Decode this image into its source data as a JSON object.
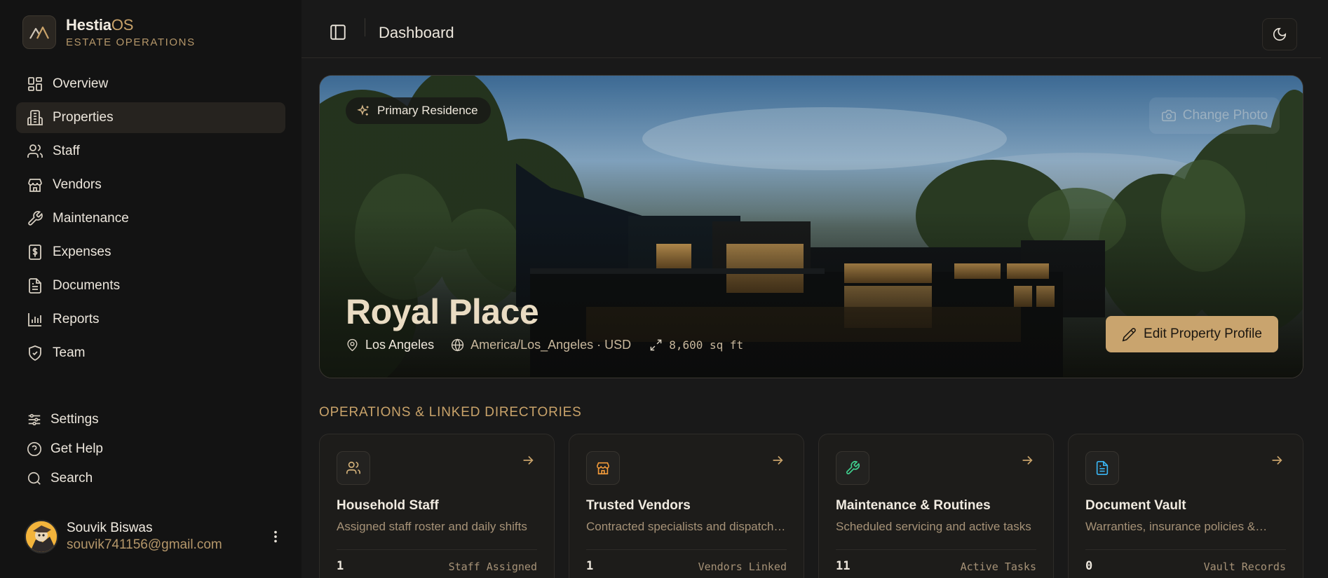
{
  "app": {
    "name_prefix": "Hestia",
    "name_suffix": "OS",
    "subtitle": "ESTATE OPERATIONS"
  },
  "sidebar": {
    "items": [
      {
        "label": "Overview",
        "icon": "grid-icon"
      },
      {
        "label": "Properties",
        "icon": "building-icon",
        "active": true
      },
      {
        "label": "Staff",
        "icon": "users-icon"
      },
      {
        "label": "Vendors",
        "icon": "store-icon"
      },
      {
        "label": "Maintenance",
        "icon": "wrench-icon"
      },
      {
        "label": "Expenses",
        "icon": "dollar-receipt-icon"
      },
      {
        "label": "Documents",
        "icon": "document-icon"
      },
      {
        "label": "Reports",
        "icon": "bar-chart-icon"
      },
      {
        "label": "Team",
        "icon": "shield-icon"
      }
    ],
    "bottom_items": [
      {
        "label": "Settings",
        "icon": "sliders-icon"
      },
      {
        "label": "Get Help",
        "icon": "help-icon"
      },
      {
        "label": "Search",
        "icon": "search-icon"
      }
    ],
    "user": {
      "name": "Souvik Biswas",
      "email": "souvik741156@gmail.com"
    }
  },
  "header": {
    "title": "Dashboard"
  },
  "hero": {
    "badge": "Primary Residence",
    "change_photo": "Change Photo",
    "title": "Royal Place",
    "city": "Los Angeles",
    "timezone_currency": "America/Los_Angeles · USD",
    "area": "8,600 sq ft",
    "edit_button": "Edit Property Profile"
  },
  "section": {
    "title": "OPERATIONS & LINKED DIRECTORIES"
  },
  "cards": [
    {
      "title": "Household Staff",
      "description": "Assigned staff roster and daily shifts",
      "count": "1",
      "label": "Staff Assigned",
      "icon": "users-icon",
      "icon_color": "#d4b27a"
    },
    {
      "title": "Trusted Vendors",
      "description": "Contracted specialists and dispatch…",
      "count": "1",
      "label": "Vendors Linked",
      "icon": "store-icon",
      "icon_color": "#f29a3a"
    },
    {
      "title": "Maintenance & Routines",
      "description": "Scheduled servicing and active tasks",
      "count": "11",
      "label": "Active Tasks",
      "icon": "wrench-icon",
      "icon_color": "#3fcf8e"
    },
    {
      "title": "Document Vault",
      "description": "Warranties, insurance policies &…",
      "count": "0",
      "label": "Vault Records",
      "icon": "document-icon",
      "icon_color": "#3ab4f2"
    }
  ],
  "colors": {
    "accent": "#c9a46e",
    "background": "#191919",
    "sidebar": "#131313"
  }
}
